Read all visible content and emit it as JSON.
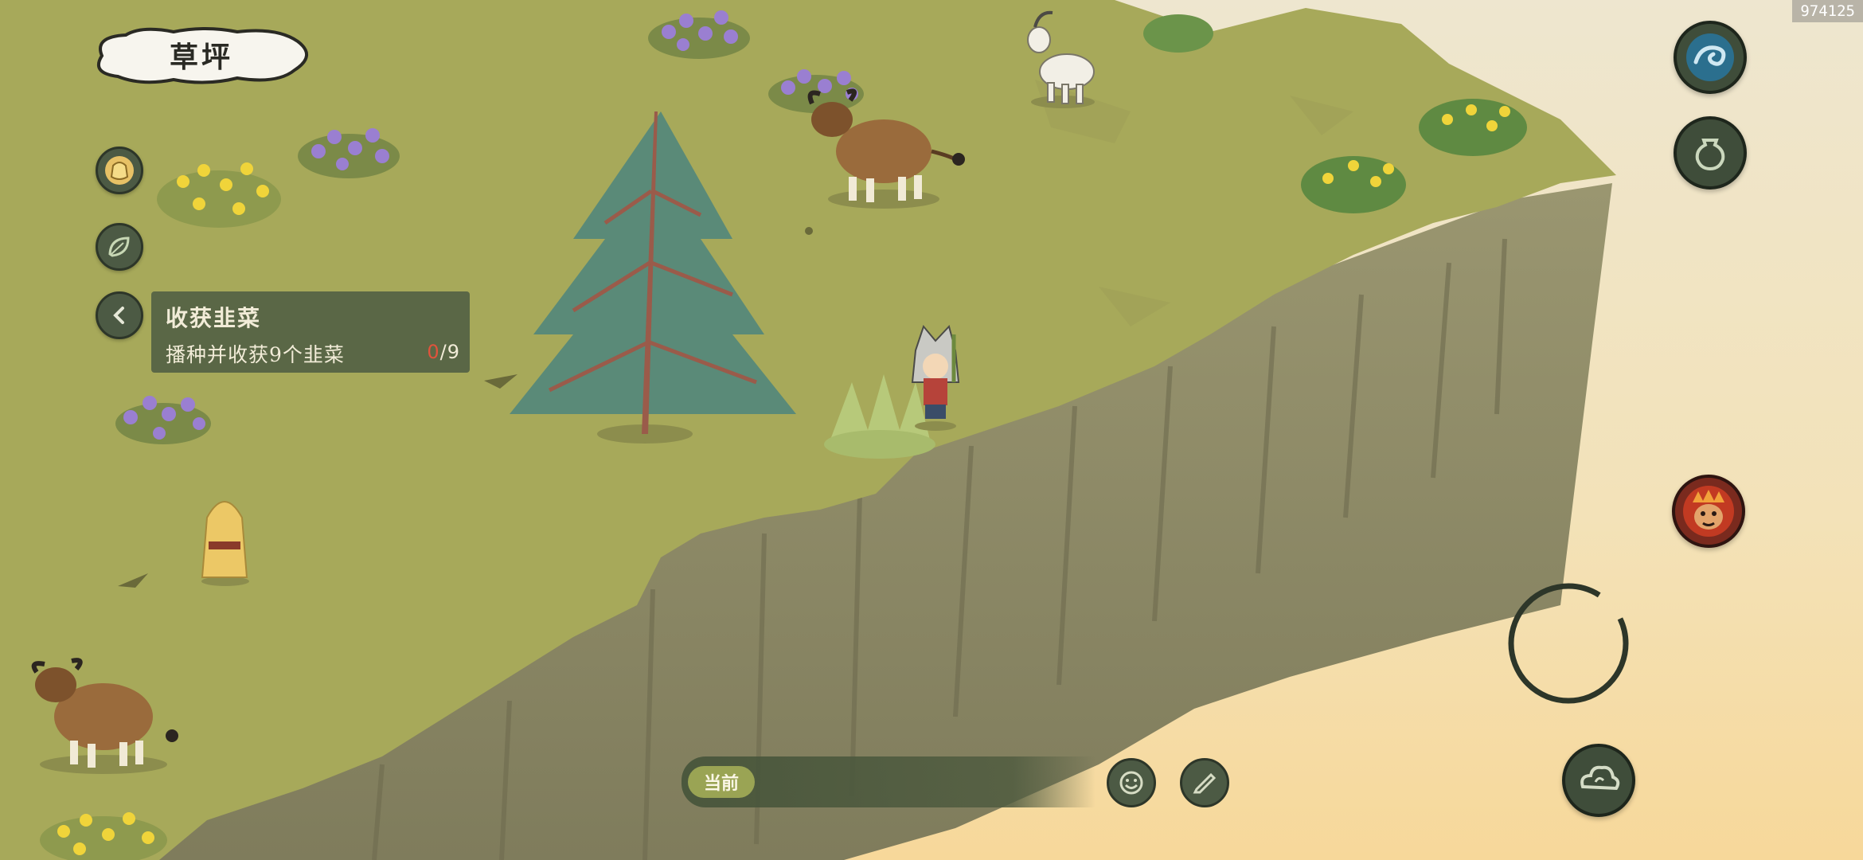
{
  "location": {
    "name": "草坪"
  },
  "quest": {
    "title": "收获韭菜",
    "description": "播种并收获9个韭菜",
    "progress_current": "0",
    "progress_total": "/9"
  },
  "chat": {
    "channel_label": "当前"
  },
  "build_id": "974125",
  "icons": {
    "left_menu": [
      "pouch-icon",
      "leaf-icon",
      "collapse-arrow-icon"
    ],
    "right_menu": [
      "wind-swirl-icon",
      "jar-icon",
      "demon-mask-icon",
      "joystick-ring-icon",
      "cloud-swirl-icon"
    ],
    "chat_buttons": [
      "emoji-icon",
      "edit-icon"
    ]
  },
  "colors": {
    "grass": "#a7a95a",
    "cliff": "#8d8a66",
    "sky": "#f1e4c2",
    "panel": "#546244",
    "progress_current": "#e0533c"
  }
}
